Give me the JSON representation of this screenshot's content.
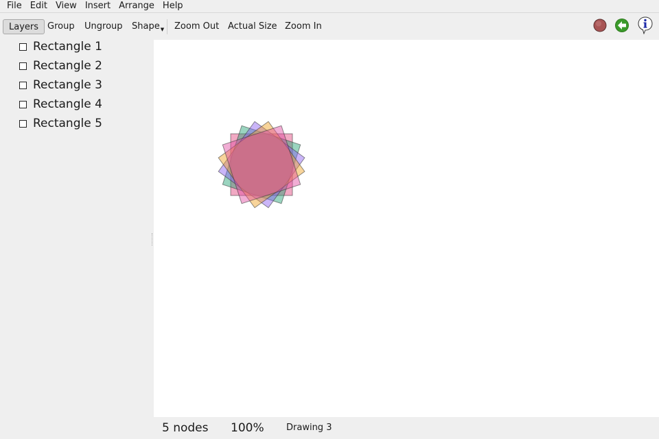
{
  "menu": [
    "File",
    "Edit",
    "View",
    "Insert",
    "Arrange",
    "Help"
  ],
  "toolbar": {
    "layers": "Layers",
    "group": "Group",
    "ungroup": "Ungroup",
    "shape": "Shape",
    "zoom_out": "Zoom Out",
    "actual_size": "Actual Size",
    "zoom_in": "Zoom In",
    "icons": [
      "record-icon",
      "back-arrow-icon",
      "info-icon"
    ]
  },
  "layers": [
    "Rectangle 1",
    "Rectangle 2",
    "Rectangle 3",
    "Rectangle 4",
    "Rectangle 5"
  ],
  "shapes": [
    {
      "name": "Rectangle 1",
      "color": "#e0407a",
      "rotation": 0
    },
    {
      "name": "Rectangle 2",
      "color": "#20a070",
      "rotation": 18
    },
    {
      "name": "Rectangle 3",
      "color": "#8a5cf0",
      "rotation": 36
    },
    {
      "name": "Rectangle 4",
      "color": "#f0a020",
      "rotation": 54
    },
    {
      "name": "Rectangle 5",
      "color": "#e04aa0",
      "rotation": 72
    }
  ],
  "status": {
    "nodes": "5 nodes",
    "zoom": "100%",
    "document": "Drawing 3"
  },
  "colors": {
    "accent_green": "#3a9a2a",
    "record_red": "#a85454",
    "info_blue": "#1c2aa8"
  }
}
